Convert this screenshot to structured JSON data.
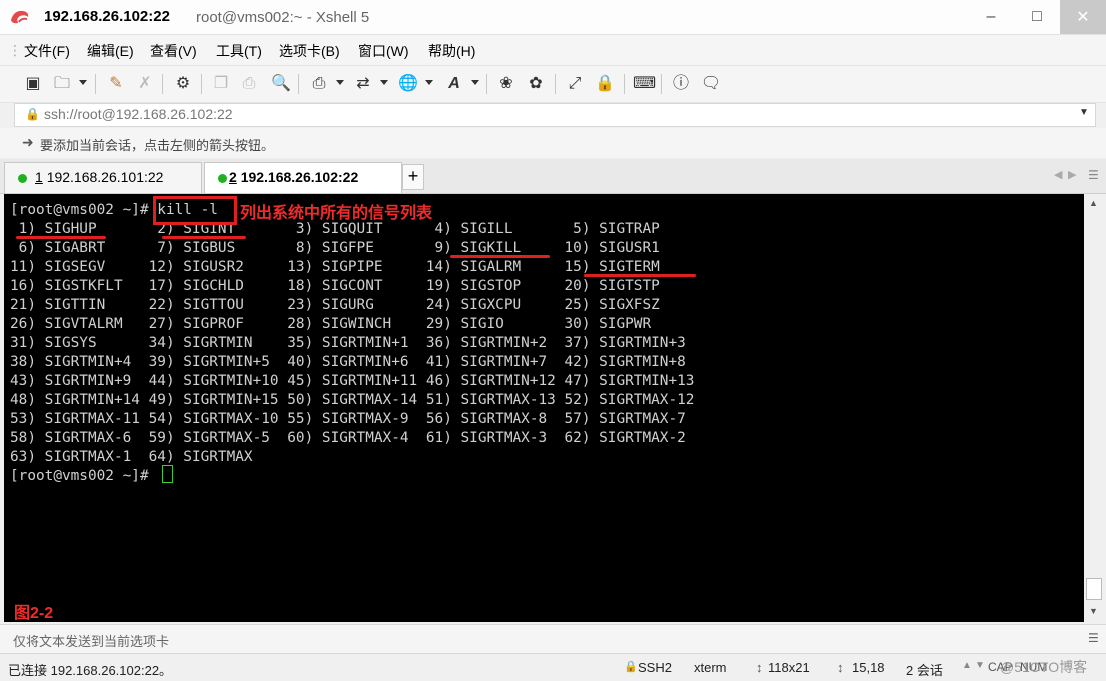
{
  "window": {
    "title_host": "192.168.26.102:22",
    "title_rest": "root@vms002:~ - Xshell 5"
  },
  "menu": [
    "文件(F)",
    "编辑(E)",
    "查看(V)",
    "工具(T)",
    "选项卡(B)",
    "窗口(W)",
    "帮助(H)"
  ],
  "address": {
    "value": "ssh://root@192.168.26.102:22"
  },
  "hint": {
    "text": "要添加当前会话，点击左侧的箭头按钮。"
  },
  "tabs": [
    {
      "number": "1",
      "label": "192.168.26.101:22"
    },
    {
      "number": "2",
      "label": "192.168.26.102:22"
    }
  ],
  "terminal": {
    "lines": [
      "[root@vms002 ~]# kill -l",
      " 1) SIGHUP       2) SIGINT       3) SIGQUIT      4) SIGILL       5) SIGTRAP",
      " 6) SIGABRT      7) SIGBUS       8) SIGFPE       9) SIGKILL     10) SIGUSR1",
      "11) SIGSEGV     12) SIGUSR2     13) SIGPIPE     14) SIGALRM     15) SIGTERM",
      "16) SIGSTKFLT   17) SIGCHLD     18) SIGCONT     19) SIGSTOP     20) SIGTSTP",
      "21) SIGTTIN     22) SIGTTOU     23) SIGURG      24) SIGXCPU     25) SIGXFSZ",
      "26) SIGVTALRM   27) SIGPROF     28) SIGWINCH    29) SIGIO       30) SIGPWR",
      "31) SIGSYS      34) SIGRTMIN    35) SIGRTMIN+1  36) SIGRTMIN+2  37) SIGRTMIN+3",
      "38) SIGRTMIN+4  39) SIGRTMIN+5  40) SIGRTMIN+6  41) SIGRTMIN+7  42) SIGRTMIN+8",
      "43) SIGRTMIN+9  44) SIGRTMIN+10 45) SIGRTMIN+11 46) SIGRTMIN+12 47) SIGRTMIN+13",
      "48) SIGRTMIN+14 49) SIGRTMIN+15 50) SIGRTMAX-14 51) SIGRTMAX-13 52) SIGRTMAX-12",
      "53) SIGRTMAX-11 54) SIGRTMAX-10 55) SIGRTMAX-9  56) SIGRTMAX-8  57) SIGRTMAX-7",
      "58) SIGRTMAX-6  59) SIGRTMAX-5  60) SIGRTMAX-4  61) SIGRTMAX-3  62) SIGRTMAX-2",
      "63) SIGRTMAX-1  64) SIGRTMAX",
      "[root@vms002 ~]# "
    ],
    "annotation": "列出系统中所有的信号列表",
    "figure_label": "图2-2",
    "annotation_color": "#e02020"
  },
  "send_bar": {
    "placeholder": "仅将文本发送到当前选项卡"
  },
  "status": {
    "connection": "已连接 192.168.26.102:22。",
    "protocol": "SSH2",
    "term": "xterm",
    "size": "118x21",
    "cursor_pos": "15,18",
    "sessions": "2 会话",
    "caps": "CAP",
    "num": "NUM",
    "watermark": "@51CTO博客"
  }
}
